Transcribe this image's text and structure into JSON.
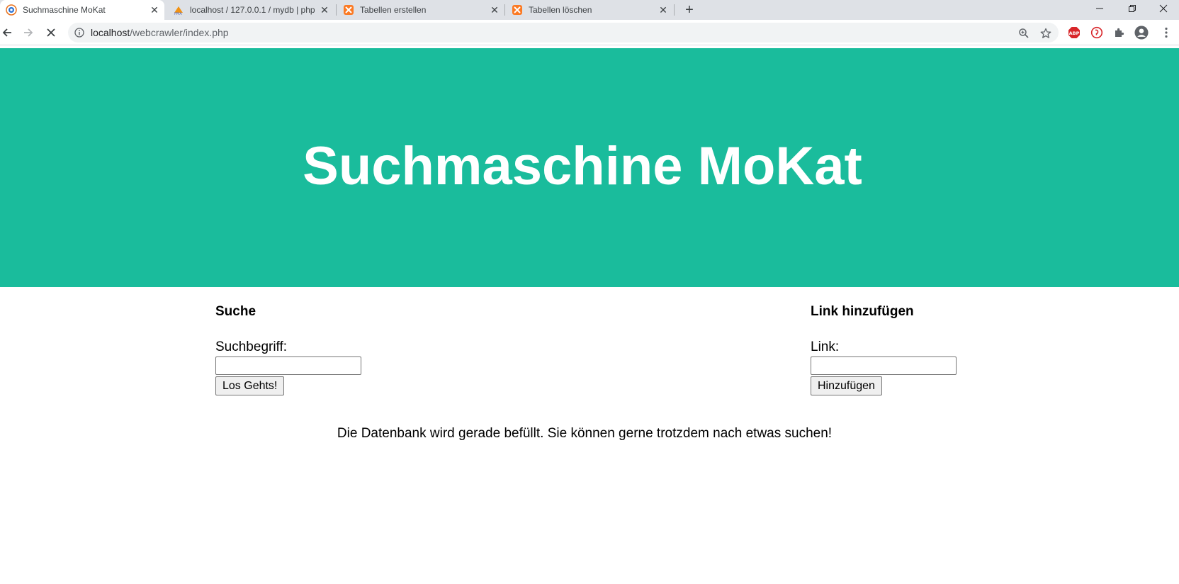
{
  "browser": {
    "tabs": [
      {
        "title": "Suchmaschine MoKat",
        "active": true,
        "icon": "xampp-globe-icon"
      },
      {
        "title": "localhost / 127.0.0.1 / mydb | php",
        "active": false,
        "icon": "phpmyadmin-icon"
      },
      {
        "title": "Tabellen erstellen",
        "active": false,
        "icon": "xampp-icon"
      },
      {
        "title": "Tabellen löschen",
        "active": false,
        "icon": "xampp-icon"
      }
    ],
    "url": {
      "host": "localhost",
      "path": "/webcrawler/index.php"
    }
  },
  "header": {
    "title": "Suchmaschine MoKat",
    "background": "#1abc9c"
  },
  "search": {
    "heading": "Suche",
    "label": "Suchbegriff:",
    "value": "",
    "button": "Los Gehts!"
  },
  "add_link": {
    "heading": "Link hinzufügen",
    "label": "Link:",
    "value": "",
    "button": "Hinzufügen"
  },
  "status_message": "Die Datenbank wird gerade befüllt. Sie können gerne trotzdem nach etwas suchen!"
}
